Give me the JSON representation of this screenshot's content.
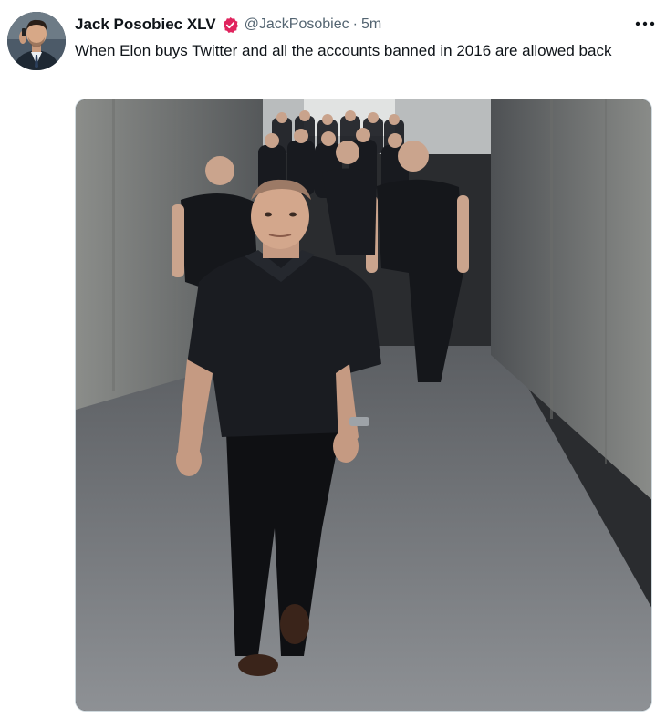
{
  "tweet": {
    "display_name": "Jack Posobiec XLV",
    "verified_icon": "verified-badge-icon",
    "handle": "@JackPosobiec",
    "separator": "·",
    "timestamp": "5m",
    "more_icon": "more-options-icon",
    "text": "When Elon buys Twitter and all the accounts banned in 2016 are allowed back"
  },
  "colors": {
    "name_text": "#0f1419",
    "secondary_text": "#536471",
    "badge_red": "#e0245e",
    "media_border": "#cfd9de"
  }
}
